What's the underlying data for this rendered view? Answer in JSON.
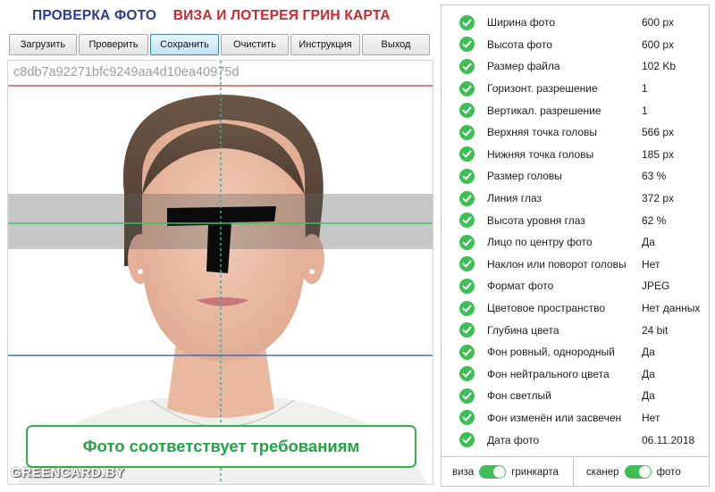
{
  "title": {
    "part1": "ПРОВЕРКА ФОТО",
    "part2": "ВИЗА И ЛОТЕРЕЯ ГРИН КАРТА"
  },
  "toolbar": {
    "load": "Загрузить",
    "check": "Проверить",
    "save": "Сохранить",
    "clear": "Очистить",
    "instructions": "Инструкция",
    "exit": "Выход"
  },
  "photo": {
    "id": "c8db7a92271bfc9249aa4d10ea40975d"
  },
  "status": "Фото соответствует требованиям",
  "watermark": "GREENCARD.BY",
  "checks": [
    {
      "label": "Ширина фото",
      "value": "600 px"
    },
    {
      "label": "Высота фото",
      "value": "600 px"
    },
    {
      "label": "Размер файла",
      "value": "102 Kb"
    },
    {
      "label": "Горизонт. разрешение",
      "value": "1"
    },
    {
      "label": "Вертикал. разрешение",
      "value": "1"
    },
    {
      "label": "Верхняя точка головы",
      "value": "566 px"
    },
    {
      "label": "Нижняя точка головы",
      "value": "185 px"
    },
    {
      "label": "Размер головы",
      "value": "63 %"
    },
    {
      "label": "Линия глаз",
      "value": "372 px"
    },
    {
      "label": "Высота уровня глаз",
      "value": "62 %"
    },
    {
      "label": "Лицо по центру фото",
      "value": "Да"
    },
    {
      "label": "Наклон или поворот головы",
      "value": "Нет"
    },
    {
      "label": "Формат фото",
      "value": "JPEG"
    },
    {
      "label": "Цветовое пространство",
      "value": "Нет данных"
    },
    {
      "label": "Глубина цвета",
      "value": "24 bit"
    },
    {
      "label": "Фон ровный, однородный",
      "value": "Да"
    },
    {
      "label": "Фон нейтрального цвета",
      "value": "Да"
    },
    {
      "label": "Фон светлый",
      "value": "Да"
    },
    {
      "label": "Фон изменён или засвечен",
      "value": "Нет"
    },
    {
      "label": "Дата фото",
      "value": "06.11.2018"
    }
  ],
  "footer": {
    "toggle1_left": "виза",
    "toggle1_right": "гринкарта",
    "toggle2_left": "сканер",
    "toggle2_right": "фото"
  },
  "colors": {
    "title_blue": "#2b3a8c",
    "title_red": "#c7292e",
    "accent_green": "#3dbf55",
    "top_line": "#d9534f",
    "eye_line": "#34c759",
    "chin_line": "#3b6cc9"
  }
}
